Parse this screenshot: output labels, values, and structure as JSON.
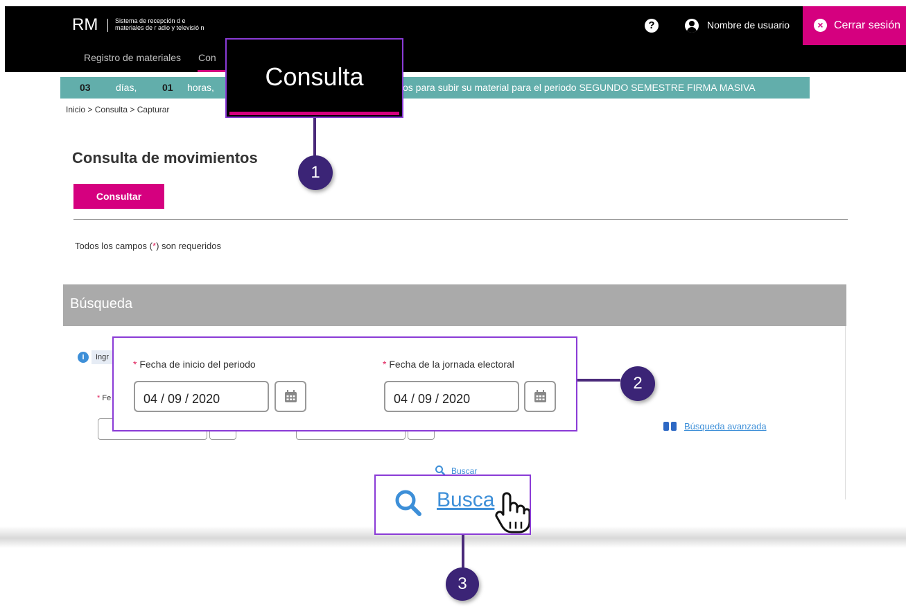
{
  "header": {
    "logo": "RM",
    "subtitle_line1": "Sistema de recepción d e",
    "subtitle_line2": "materiales de r adio y televisió n",
    "help_label": "?",
    "user_name": "Nombre de usuario",
    "logout_label": "Cerrar sesión"
  },
  "nav": {
    "items": [
      "Registro de materiales",
      "Con"
    ]
  },
  "countdown": {
    "days_value": "03",
    "days_label": "días,",
    "hours_value": "01",
    "hours_label": "horas,",
    "message": "os para subir su material para el periodo SEGUNDO SEMESTRE  FIRMA MASIVA"
  },
  "breadcrumb": "Inicio > Consulta >  Capturar",
  "page": {
    "title": "Consulta de movimientos",
    "consult_button": "Consultar",
    "required_prefix": "Todos los campos (",
    "required_star": "*",
    "required_suffix": ") son requeridos"
  },
  "search_panel": {
    "title": "Búsqueda",
    "info_text": "Ingr",
    "bg_label": "Fe",
    "advanced_link": "Búsqueda avanzada",
    "search_label": "Buscar"
  },
  "callouts": {
    "zoom_tab": "Consulta",
    "field1_label": "Fecha de inicio del periodo",
    "field1_value": "04 / 09 / 2020",
    "field2_label": "Fecha de la jornada electoral",
    "field2_value": "04 / 09 / 2020",
    "zoom_search": "Busca",
    "badges": [
      "1",
      "2",
      "3"
    ]
  },
  "colors": {
    "brand_magenta": "#d5007f",
    "countdown_teal": "#62aeab",
    "callout_purple": "#8a3bd6",
    "badge_purple": "#3b2476",
    "link_blue": "#3d8fd8"
  }
}
